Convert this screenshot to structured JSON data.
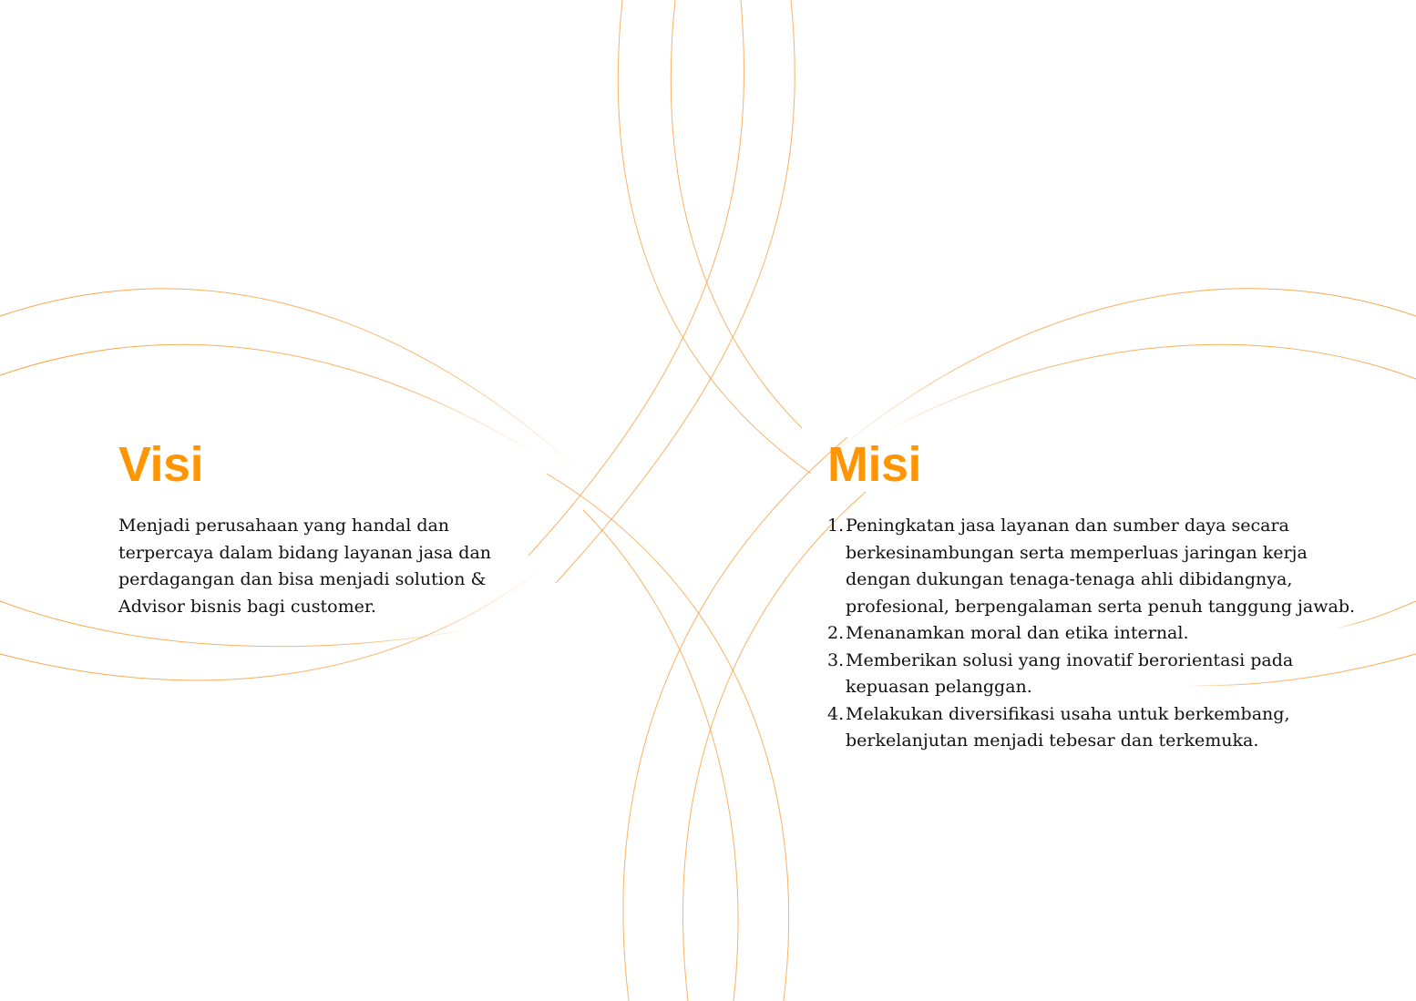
{
  "theme": {
    "accent": "#ff9500",
    "line": "#f7a54a",
    "text": "#111111",
    "background": "#ffffff"
  },
  "visi": {
    "heading": "Visi",
    "body": "Menjadi perusahaan yang handal dan terpercaya dalam bidang layanan jasa dan perdagangan dan bisa menjadi solution & Advisor bisnis bagi customer."
  },
  "misi": {
    "heading": "Misi",
    "items": [
      {
        "num": "1.",
        "text": "Peningkatan jasa layanan dan sumber daya secara berkesinambungan serta memperluas jaringan kerja dengan dukungan tenaga-tenaga ahli dibidangnya, profesional, berpengalaman serta penuh tanggung jawab."
      },
      {
        "num": "2.",
        "text": "Menanamkan moral dan etika internal."
      },
      {
        "num": "3.",
        "text": "Memberikan solusi yang inovatif berorientasi pada kepuasan pelanggan."
      },
      {
        "num": "4.",
        "text": "Melakukan diversifikasi usaha untuk berkembang, berkelanjutan menjadi tebesar dan terkemuka."
      }
    ]
  }
}
